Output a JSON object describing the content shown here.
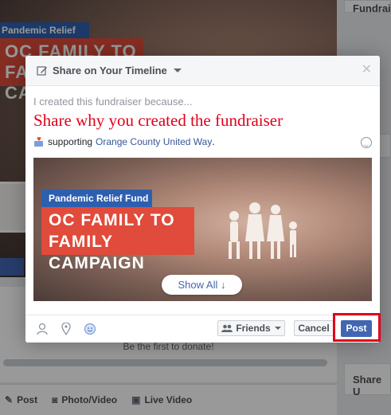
{
  "background": {
    "badge_text": "Pandemic Relief Fund",
    "banner_text": "OC FAMILY TO FAMILY CAMPAIGN",
    "right_card_top": "Fundrai",
    "right_card_mid": "Fu",
    "right_card_bottom": "Share U",
    "first_to_donate": "Be the first to donate!",
    "composer": {
      "post_label": "Post",
      "photo_label": "Photo/Video",
      "live_label": "Live Video"
    }
  },
  "modal": {
    "title": "Share on Your Timeline",
    "placeholder": "I created this fundraiser because...",
    "annotation": "Share why you created the fundraiser",
    "supporting_prefix": "supporting",
    "organization": "Orange County United Way",
    "photo": {
      "badge": "Pandemic Relief Fund",
      "banner_line1": "OC FAMILY TO FAMILY",
      "banner_line2": "CAMPAIGN"
    },
    "show_all": "Show All ↓",
    "footer": {
      "audience": "Friends",
      "cancel": "Cancel",
      "post": "Post"
    }
  },
  "colors": {
    "accent": "#4267b2",
    "annotation_red": "#e0001b",
    "link": "#365899"
  }
}
